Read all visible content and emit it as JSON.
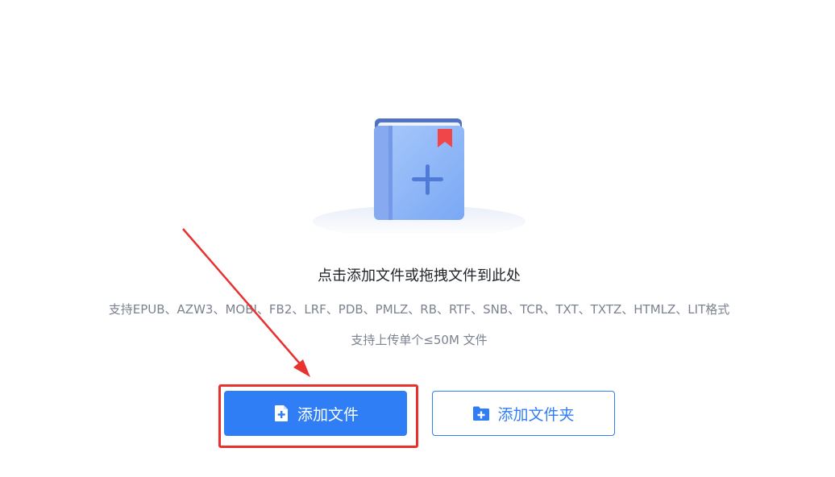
{
  "upload": {
    "title": "点击添加文件或拖拽文件到此处",
    "formats": "支持EPUB、AZW3、MOBI、FB2、LRF、PDB、PMLZ、RB、RTF、SNB、TCR、TXT、TXTZ、HTMLZ、LIT格式",
    "size_limit": "支持上传单个≤50M 文件"
  },
  "buttons": {
    "add_file": "添加文件",
    "add_folder": "添加文件夹"
  },
  "icons": {
    "illustration": "book-plus-icon",
    "add_file": "file-plus-icon",
    "add_folder": "folder-plus-icon"
  },
  "colors": {
    "primary": "#2f7ef5",
    "annotation": "#e8322f",
    "title_text": "#1f2329",
    "muted_text": "#7b8290"
  }
}
